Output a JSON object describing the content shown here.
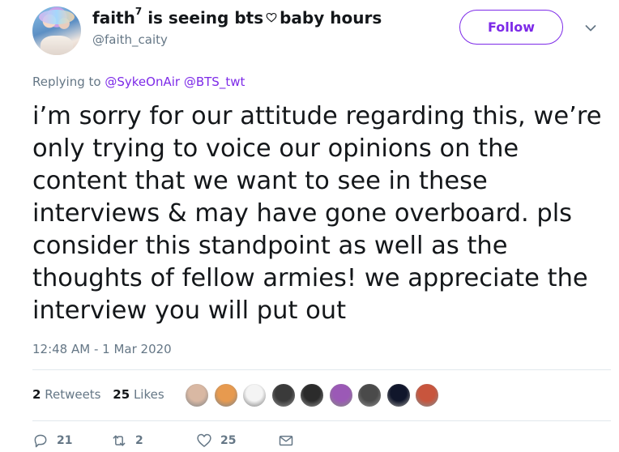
{
  "author": {
    "display_name": "faith",
    "name_superscript": "7",
    "display_name_rest": "is seeing bts",
    "display_name_tail": "baby hours",
    "username": "@faith_caity"
  },
  "follow": {
    "label": "Follow"
  },
  "reply": {
    "prefix": "Replying to",
    "mentions": [
      "@SykeOnAir",
      "@BTS_twt"
    ]
  },
  "tweet": {
    "lines": [
      "i’m sorry for our attitude regarding this, we’re",
      "only trying to voice our opinions on the",
      "content that we want to see in these",
      "interviews & may have gone overboard. pls",
      "consider this standpoint as well as the",
      "thoughts of fellow armies! we appreciate the",
      "interview you will put out"
    ],
    "timestamp": "12:48 AM - 1 Mar 2020"
  },
  "stats": {
    "retweets_count": "2",
    "retweets_label": "Retweets",
    "likes_count": "25",
    "likes_label": "Likes"
  },
  "likers": {
    "colors": [
      "#d9b8a3",
      "#e79a4f",
      "#f4f4f4",
      "#3a3a3a",
      "#2b2b2b",
      "#9b59b6",
      "#4a4a4a",
      "#10162b",
      "#c8553d"
    ]
  },
  "actions": {
    "reply_count": "21",
    "retweet_count": "2",
    "like_count": "25"
  },
  "colors": {
    "accent": "#7d2ae8",
    "secondary_text": "#657786",
    "text": "#14171a"
  }
}
